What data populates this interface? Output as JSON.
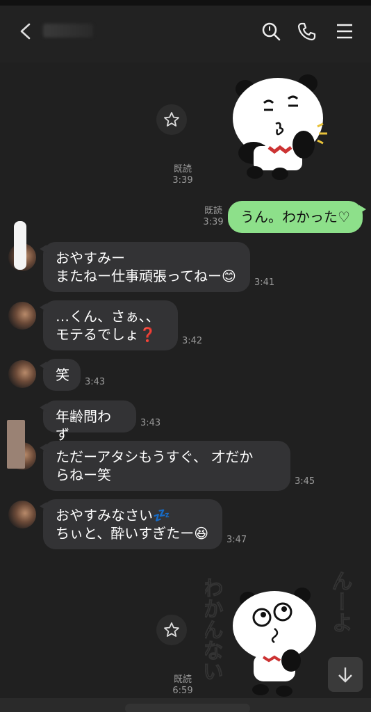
{
  "header": {
    "title": "",
    "icons": [
      "back-icon",
      "search-icon",
      "phone-icon",
      "menu-icon"
    ]
  },
  "messages": [
    {
      "type": "sticker-out",
      "read": "既読",
      "time": "3:39"
    },
    {
      "type": "text-out",
      "text": "うん。わかった♡",
      "read": "既読",
      "time": "3:39"
    },
    {
      "type": "text-in",
      "text": "おやすみー\nまたねー仕事頑張ってねー😊",
      "time": "3:41"
    },
    {
      "type": "text-in",
      "text": "…くん、さぁ、、\nモテるでしょ❓",
      "time": "3:42"
    },
    {
      "type": "text-in",
      "text": "笑",
      "time": "3:43"
    },
    {
      "type": "text-in",
      "text": "年齢問わず",
      "time": "3:43"
    },
    {
      "type": "text-in",
      "text": "ただーアタシもうすぐ、 才だか\nらねー笑",
      "time": "3:45"
    },
    {
      "type": "text-in",
      "text": "おやすみなさい💤\nちぃと、酔いすぎたー😆",
      "time": "3:47"
    },
    {
      "type": "sticker-out",
      "sticker_text_left": "わかんない",
      "sticker_text_right": "んーよ",
      "read": "既読",
      "time": "6:59"
    }
  ],
  "colors": {
    "background": "#202020",
    "incoming_bubble": "#333335",
    "outgoing_bubble": "#8de08a"
  }
}
